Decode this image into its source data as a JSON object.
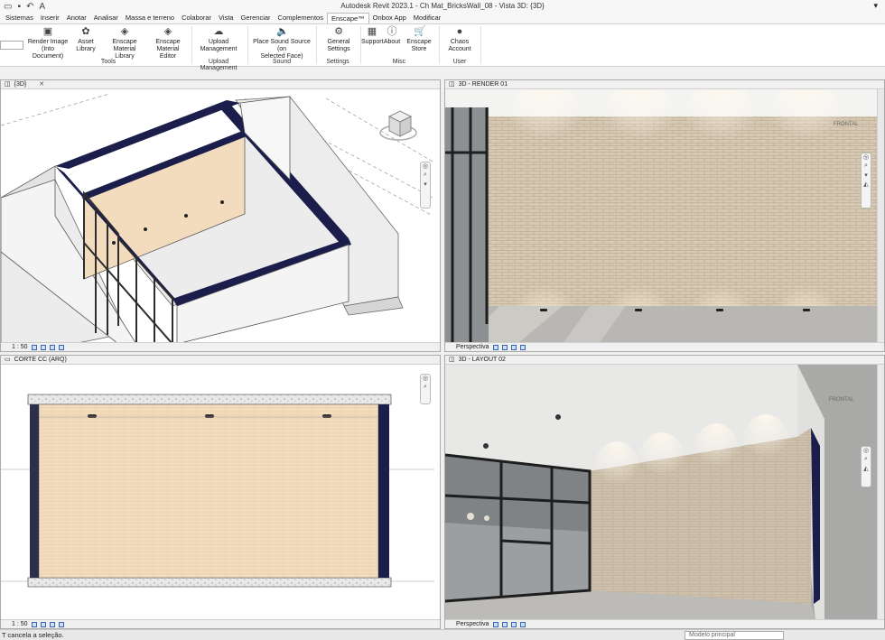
{
  "window": {
    "title": "Autodesk Revit 2023.1 - Ch Mat_BricksWall_08 - Vista 3D: {3D}",
    "qat_icons": [
      "open-icon",
      "save-icon",
      "undo-icon",
      "text-a-icon"
    ],
    "qat_text": "A",
    "win_glyph": "▾"
  },
  "menu_tabs": [
    {
      "label": "Sistemas",
      "active": false
    },
    {
      "label": "Inserir",
      "active": false
    },
    {
      "label": "Anotar",
      "active": false
    },
    {
      "label": "Analisar",
      "active": false
    },
    {
      "label": "Massa e terreno",
      "active": false
    },
    {
      "label": "Colaborar",
      "active": false
    },
    {
      "label": "Vista",
      "active": false
    },
    {
      "label": "Gerenciar",
      "active": false
    },
    {
      "label": "Complementos",
      "active": false
    },
    {
      "label": "Enscape™",
      "active": true
    },
    {
      "label": "Onbox App",
      "active": false
    },
    {
      "label": "Modificar",
      "active": false
    }
  ],
  "ribbon": {
    "buttons": [
      {
        "label": "Render Image\n(Into Document)",
        "icon": "render-icon",
        "glyph": "▣"
      },
      {
        "label": "Asset Library",
        "icon": "asset-library-icon",
        "glyph": "✿"
      },
      {
        "label": "Enscape Material\nLibrary",
        "icon": "material-library-icon",
        "glyph": "◈"
      },
      {
        "label": "Enscape Material\nEditor",
        "icon": "material-editor-icon",
        "glyph": "◈"
      },
      {
        "label": "Upload\nManagement",
        "icon": "cloud-upload-icon",
        "glyph": "☁"
      },
      {
        "label": "Place Sound Source (on\nSelected Face)",
        "icon": "speaker-icon",
        "glyph": "🔈"
      },
      {
        "label": "General Settings",
        "icon": "gears-icon",
        "glyph": "⚙"
      },
      {
        "label": "Support",
        "icon": "support-icon",
        "glyph": "▦"
      },
      {
        "label": "About",
        "icon": "info-icon",
        "glyph": "ⓘ"
      },
      {
        "label": "Enscape Store",
        "icon": "cart-icon",
        "glyph": "🛒"
      },
      {
        "label": "Chaos Account",
        "icon": "account-icon",
        "glyph": "●"
      }
    ],
    "panels": [
      "Tools",
      "Upload Management",
      "Sound",
      "Settings",
      "Misc",
      "User"
    ]
  },
  "viewports": {
    "v3d": {
      "title": "{3D}",
      "scale": "1 : 50",
      "close": "✕"
    },
    "render": {
      "title": "3D - RENDER 01",
      "mode": "Perspectiva",
      "cube_label": "FRONTAL"
    },
    "section": {
      "title": "CORTE CC (ARQ)",
      "scale": "1 : 50"
    },
    "layout": {
      "title": "3D - LAYOUT 02",
      "mode": "Perspectiva",
      "cube_label": "FRONTAL"
    }
  },
  "status": {
    "text": "T cancela a seleção.",
    "model": "Modelo principal"
  },
  "colors": {
    "accent": "#3466b1",
    "brick": "#d2c3ae",
    "beige_wall": "#f3dcbd",
    "navy_frame": "#1b1d4b"
  }
}
